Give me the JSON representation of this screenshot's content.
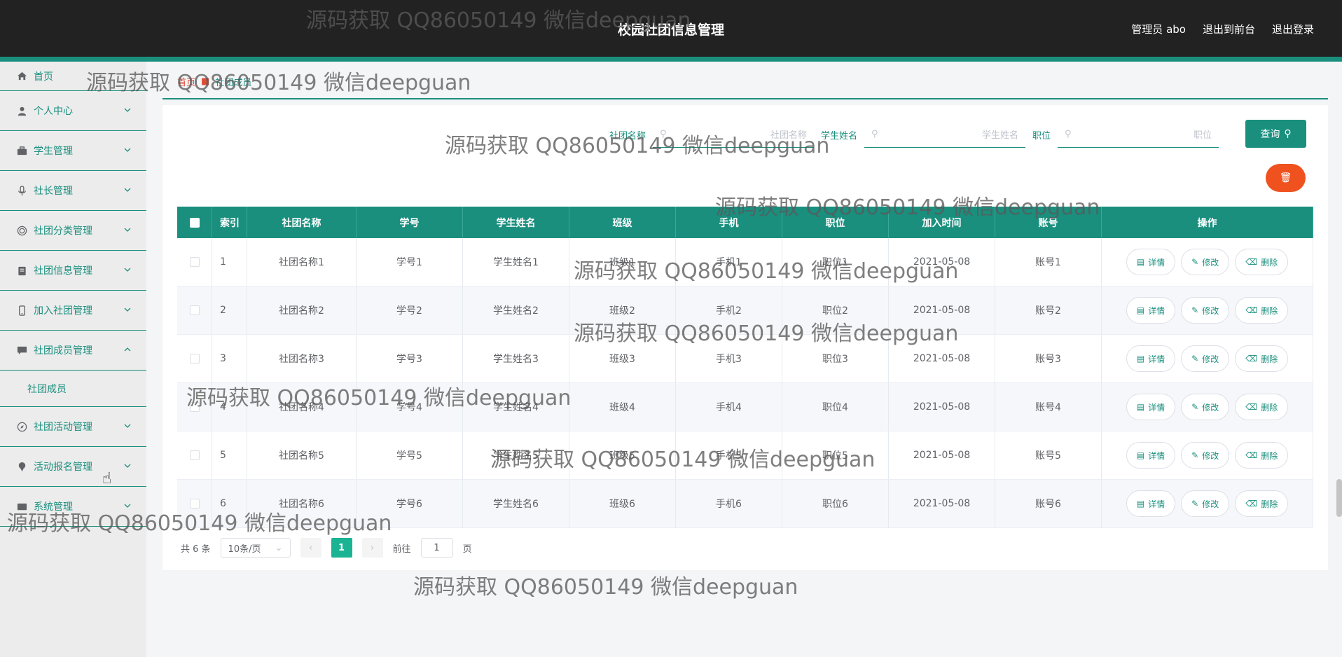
{
  "header": {
    "title": "校园社团信息管理",
    "admin_label": "管理员 abo",
    "front_label": "退出到前台",
    "logout_label": "退出登录"
  },
  "sidebar": {
    "home": "首页",
    "items": [
      {
        "label": "个人中心",
        "icon": "user-icon"
      },
      {
        "label": "学生管理",
        "icon": "briefcase-icon"
      },
      {
        "label": "社长管理",
        "icon": "microphone-icon"
      },
      {
        "label": "社团分类管理",
        "icon": "target-icon"
      },
      {
        "label": "社团信息管理",
        "icon": "clipboard-icon"
      },
      {
        "label": "加入社团管理",
        "icon": "phone-icon"
      },
      {
        "label": "社团成员管理",
        "icon": "chat-icon",
        "expanded": true,
        "sub": "社团成员"
      },
      {
        "label": "社团活动管理",
        "icon": "compass-icon"
      },
      {
        "label": "活动报名管理",
        "icon": "pin-icon"
      },
      {
        "label": "系统管理",
        "icon": "system-icon"
      }
    ]
  },
  "breadcrumb": {
    "home": "首页",
    "current": "社团成员"
  },
  "search": {
    "club_label": "社团名称",
    "club_placeholder": "社团名称",
    "student_label": "学生姓名",
    "student_placeholder": "学生姓名",
    "position_label": "职位",
    "position_placeholder": "职位",
    "query_label": "查询"
  },
  "table": {
    "headers": [
      "索引",
      "社团名称",
      "学号",
      "学生姓名",
      "班级",
      "手机",
      "职位",
      "加入时间",
      "账号",
      "操作"
    ],
    "rows": [
      {
        "idx": "1",
        "club": "社团名称1",
        "sno": "学号1",
        "name": "学生姓名1",
        "cls": "班级1",
        "phone": "手机1",
        "pos": "职位1",
        "time": "2021-05-08",
        "acct": "账号1"
      },
      {
        "idx": "2",
        "club": "社团名称2",
        "sno": "学号2",
        "name": "学生姓名2",
        "cls": "班级2",
        "phone": "手机2",
        "pos": "职位2",
        "time": "2021-05-08",
        "acct": "账号2"
      },
      {
        "idx": "3",
        "club": "社团名称3",
        "sno": "学号3",
        "name": "学生姓名3",
        "cls": "班级3",
        "phone": "手机3",
        "pos": "职位3",
        "time": "2021-05-08",
        "acct": "账号3"
      },
      {
        "idx": "4",
        "club": "社团名称4",
        "sno": "学号4",
        "name": "学生姓名4",
        "cls": "班级4",
        "phone": "手机4",
        "pos": "职位4",
        "time": "2021-05-08",
        "acct": "账号4"
      },
      {
        "idx": "5",
        "club": "社团名称5",
        "sno": "学号5",
        "name": "学生姓名5",
        "cls": "班级5",
        "phone": "手机5",
        "pos": "职位5",
        "time": "2021-05-08",
        "acct": "账号5"
      },
      {
        "idx": "6",
        "club": "社团名称6",
        "sno": "学号6",
        "name": "学生姓名6",
        "cls": "班级6",
        "phone": "手机6",
        "pos": "职位6",
        "time": "2021-05-08",
        "acct": "账号6"
      }
    ],
    "actions": {
      "detail": "详情",
      "edit": "修改",
      "delete": "删除"
    }
  },
  "pager": {
    "total": "共 6 条",
    "size": "10条/页",
    "current": "1",
    "goto_prefix": "前往",
    "goto_value": "1",
    "goto_suffix": "页"
  },
  "watermark": "源码获取 QQ86050149 微信deepguan",
  "colors": {
    "accent": "#1a8f7e",
    "header_bg": "#222222",
    "danger": "#f0521f",
    "page_active": "#1ab394"
  }
}
